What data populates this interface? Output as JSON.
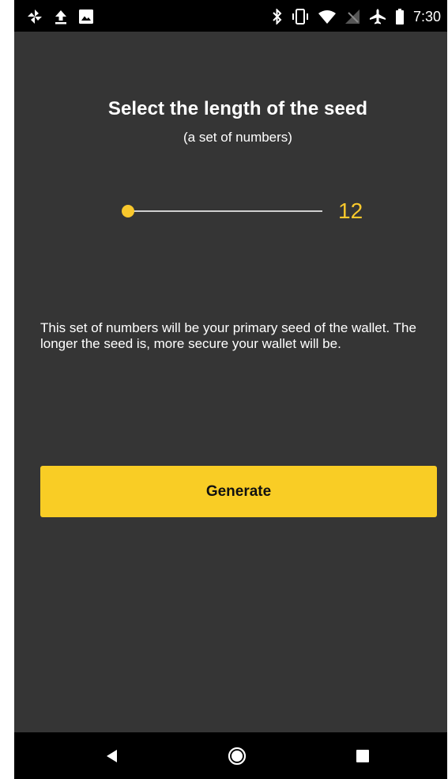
{
  "status_bar": {
    "left_icons": [
      "pinwheel-icon",
      "upload-icon",
      "image-icon"
    ],
    "right_icons": [
      "bluetooth-icon",
      "vibrate-icon",
      "wifi-icon",
      "no-signal-icon",
      "airplane-mode-icon",
      "battery-icon"
    ],
    "time": "7:30"
  },
  "main": {
    "title": "Select the length of the seed",
    "subtitle": "(a set of numbers)",
    "slider": {
      "value": "12",
      "fill_fraction": 0.0,
      "accent_color": "#f9c82c"
    },
    "info_text": "This set of numbers will be your primary seed of the wallet. The longer the seed is, more secure your wallet will be.",
    "generate_label": "Generate",
    "button_color": "#f9cd25",
    "background_color": "#353535"
  },
  "nav_bar": {
    "icons": [
      "back-icon",
      "home-icon",
      "recents-icon"
    ]
  }
}
